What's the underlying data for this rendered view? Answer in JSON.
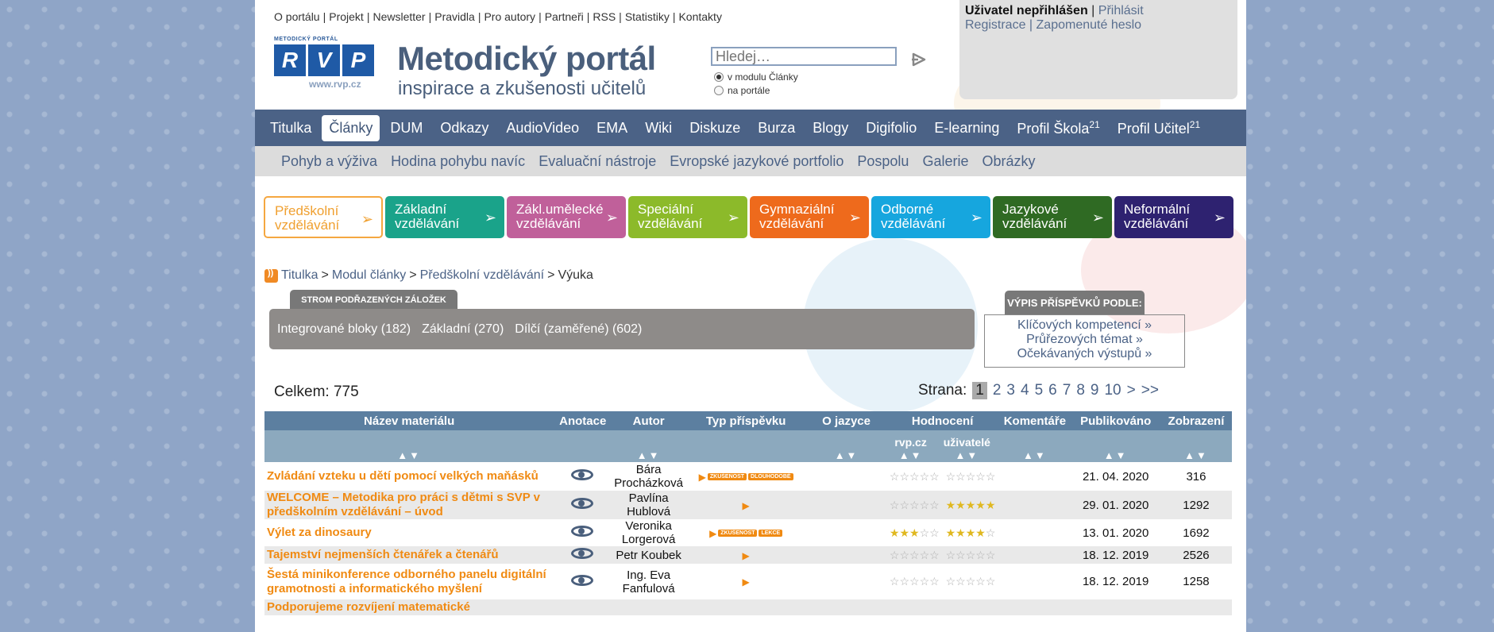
{
  "top_links": [
    "O portálu",
    "Projekt",
    "Newsletter",
    "Pravidla",
    "Pro autory",
    "Partneři",
    "RSS",
    "Statistiky",
    "Kontakty"
  ],
  "logo": {
    "small_caption": "METODICKÝ PORTÁL",
    "letters": [
      "R",
      "V",
      "P"
    ],
    "url": "www.rvp.cz",
    "title": "Metodický portál",
    "subtitle": "inspirace a zkušenosti učitelů"
  },
  "search": {
    "placeholder": "Hledej…",
    "options": [
      "v modulu Články",
      "na portále"
    ],
    "selected": 0
  },
  "login": {
    "status": "Uživatel nepřihlášen",
    "login_link": "Přihlásit",
    "register_link": "Registrace",
    "forgot_link": "Zapomenuté heslo"
  },
  "main_nav": {
    "active": 1,
    "items": [
      {
        "label": "Titulka",
        "sup": ""
      },
      {
        "label": "Články",
        "sup": ""
      },
      {
        "label": "DUM",
        "sup": ""
      },
      {
        "label": "Odkazy",
        "sup": ""
      },
      {
        "label": "AudioVideo",
        "sup": ""
      },
      {
        "label": "EMA",
        "sup": ""
      },
      {
        "label": "Wiki",
        "sup": ""
      },
      {
        "label": "Diskuze",
        "sup": ""
      },
      {
        "label": "Burza",
        "sup": ""
      },
      {
        "label": "Blogy",
        "sup": ""
      },
      {
        "label": "Digifolio",
        "sup": ""
      },
      {
        "label": "E-learning",
        "sup": ""
      },
      {
        "label": "Profil Škola",
        "sup": "21"
      },
      {
        "label": "Profil Učitel",
        "sup": "21"
      }
    ]
  },
  "sub_nav": [
    "Pohyb a výživa",
    "Hodina pohybu navíc",
    "Evaluační nástroje",
    "Evropské jazykové portfolio",
    "Pospolu",
    "Galerie",
    "Obrázky"
  ],
  "categories": [
    {
      "l1": "Předškolní",
      "l2": "vzdělávání",
      "color": "#ffffff"
    },
    {
      "l1": "Základní",
      "l2": "vzdělávání",
      "color": "#1aa38a"
    },
    {
      "l1": "Zákl.umělecké",
      "l2": "vzdělávání",
      "color": "#c0609a"
    },
    {
      "l1": "Speciální",
      "l2": "vzdělávání",
      "color": "#8cba2a"
    },
    {
      "l1": "Gymnaziální",
      "l2": "vzdělávání",
      "color": "#ee6a1c"
    },
    {
      "l1": "Odborné",
      "l2": "vzdělávání",
      "color": "#16a6de"
    },
    {
      "l1": "Jazykové",
      "l2": "vzdělávání",
      "color": "#2f6a23"
    },
    {
      "l1": "Neformální",
      "l2": "vzdělávání",
      "color": "#2e2270"
    }
  ],
  "breadcrumb": [
    "Titulka",
    "Modul články",
    "Předškolní vzdělávání",
    "Výuka"
  ],
  "tree": {
    "tab": "STROM PODŘAZENÝCH ZÁLOŽEK",
    "items": [
      "Integrované bloky (182)",
      "Základní (270)",
      "Dílčí (zaměřené) (602)"
    ]
  },
  "vypis": {
    "tab": "VÝPIS PŘÍSPĚVKŮ PODLE:",
    "links": [
      "Klíčových kompetencí »",
      "Průřezových témat »",
      "Očekávaných výstupů »"
    ]
  },
  "total": "Celkem: 775",
  "pager": {
    "label": "Strana:",
    "current": "1",
    "pages": [
      "2",
      "3",
      "4",
      "5",
      "6",
      "7",
      "8",
      "9",
      "10"
    ],
    "next": ">",
    "last": ">>"
  },
  "table": {
    "headers": [
      "Název materiálu",
      "Anotace",
      "Autor",
      "Typ příspěvku",
      "O jazyce",
      "Hodnocení",
      "Komentáře",
      "Publikováno",
      "Zobrazení"
    ],
    "rating_sub": [
      "rvp.cz",
      "uživatelé"
    ],
    "sort_icon": "▲▼",
    "rows": [
      {
        "title": "Zvládání vzteku u dětí pomocí velkých maňásků",
        "author": "Bára Procházková",
        "badges": [
          "ZKUŠENOST",
          "DLOUHODOBÉ"
        ],
        "rvp_rating": 0,
        "user_rating": 0,
        "date": "21. 04. 2020",
        "views": "316"
      },
      {
        "title": "WELCOME – Metodika pro práci s dětmi s SVP v předškolním vzdělávání – úvod",
        "author": "Pavlína Hublová",
        "badges": [],
        "rvp_rating": 0,
        "user_rating": 5,
        "date": "29. 01. 2020",
        "views": "1292"
      },
      {
        "title": "Výlet za dinosaury",
        "author": "Veronika Lorgerová",
        "badges": [
          "ZKUŠENOST",
          "LEKCE"
        ],
        "rvp_rating": 3,
        "user_rating": 4,
        "date": "13. 01. 2020",
        "views": "1692"
      },
      {
        "title": "Tajemství nejmenších čtenářek a čtenářů",
        "author": "Petr Koubek",
        "badges": [],
        "rvp_rating": 0,
        "user_rating": 0,
        "date": "18. 12. 2019",
        "views": "2526"
      },
      {
        "title": "Šestá minikonference odborného panelu digitální gramotnosti a informatického myšlení",
        "author": "Ing. Eva Fanfulová",
        "badges": [],
        "rvp_rating": 0,
        "user_rating": 0,
        "date": "18. 12. 2019",
        "views": "1258"
      },
      {
        "title": "Podporujeme rozvíjení matematické",
        "author": "",
        "badges": [],
        "rvp_rating": 0,
        "user_rating": 0,
        "date": "",
        "views": ""
      }
    ]
  }
}
